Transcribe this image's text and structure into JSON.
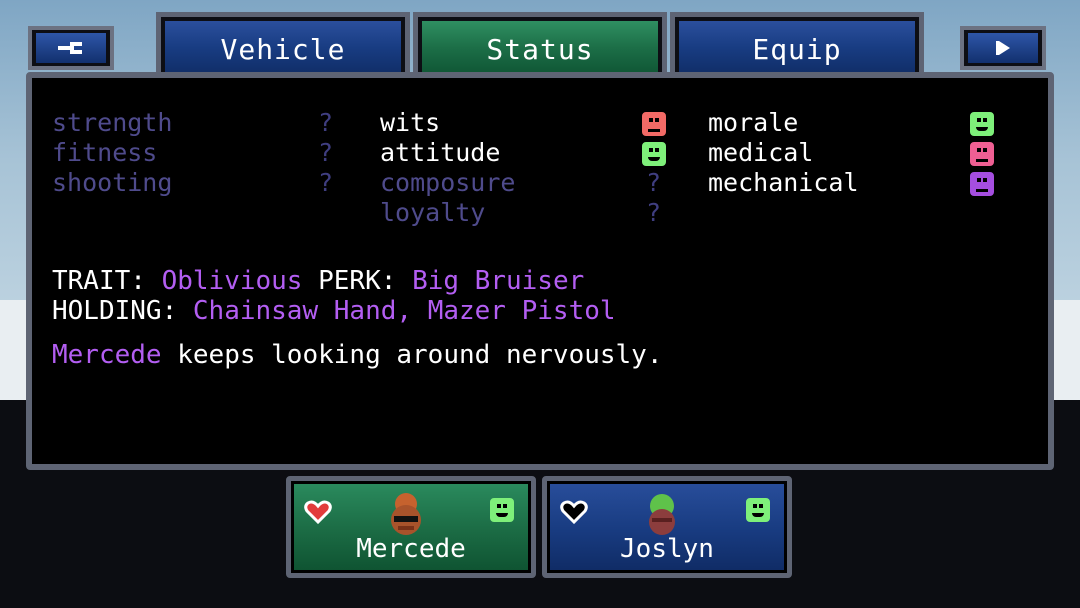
{
  "nav": {
    "back_icon": "back-icon",
    "next_icon": "next-icon"
  },
  "tabs": [
    {
      "label": "Vehicle",
      "active": false
    },
    {
      "label": "Status",
      "active": true
    },
    {
      "label": "Equip",
      "active": false
    }
  ],
  "stats": {
    "col1": [
      {
        "label": "strength",
        "value": "?",
        "known": false
      },
      {
        "label": "fitness",
        "value": "?",
        "known": false
      },
      {
        "label": "shooting",
        "value": "?",
        "known": false
      }
    ],
    "col2": [
      {
        "label": "wits",
        "mood": "red-sad",
        "known": true
      },
      {
        "label": "attitude",
        "mood": "green-happy",
        "known": true
      },
      {
        "label": "composure",
        "value": "?",
        "known": false
      },
      {
        "label": "loyalty",
        "value": "?",
        "known": false
      }
    ],
    "col3": [
      {
        "label": "morale",
        "mood": "green-happy",
        "known": true
      },
      {
        "label": "medical",
        "mood": "pink-sad",
        "known": true
      },
      {
        "label": "mechanical",
        "mood": "purple-sad",
        "known": true
      }
    ]
  },
  "info": {
    "trait_label": "TRAIT:",
    "trait_value": "Oblivious",
    "perk_label": "PERK:",
    "perk_value": "Big Bruiser",
    "holding_label": "HOLDING:",
    "holding_value": "Chainsaw Hand, Mazer Pistol",
    "desc_name": "Mercede",
    "desc_text": " keeps looking around nervously."
  },
  "characters": [
    {
      "name": "Mercede",
      "health": "full",
      "mood": "green-happy",
      "selected": true
    },
    {
      "name": "Joslyn",
      "health": "empty",
      "mood": "green-happy",
      "selected": false
    }
  ],
  "colors": {
    "accent_purple": "#b35ef2",
    "tab_green": "#1c6e47",
    "tab_blue": "#183c82",
    "frame": "#5e6474"
  }
}
